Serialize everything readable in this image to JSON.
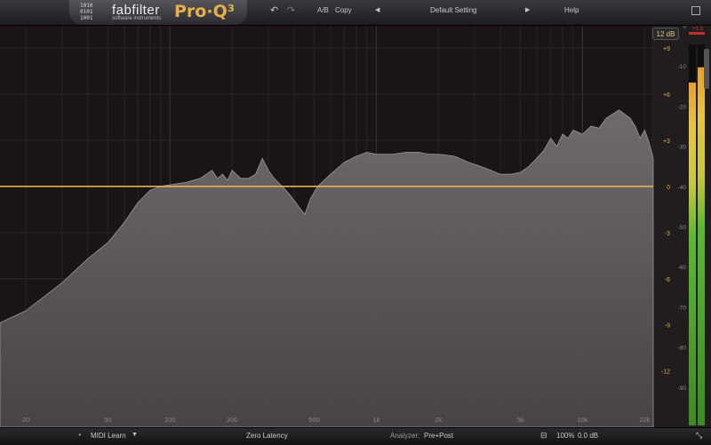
{
  "app": {
    "brand": "fabfilter",
    "brand_sub": "software instruments",
    "product": "Pro·Q³",
    "logo_bits": "1010\n0101\n1001"
  },
  "toolbar": {
    "undo_icon": "undo-icon",
    "redo_icon": "redo-icon",
    "ab_label": "A/B",
    "copy_label": "Copy",
    "preset_name": "Default Setting",
    "help_label": "Help"
  },
  "range": {
    "label": "12 dB"
  },
  "eq_scale": [
    "+9",
    "+6",
    "+3",
    "0",
    "-3",
    "-6",
    "-9",
    "-12"
  ],
  "eq_scale_values": [
    9,
    6,
    3,
    0,
    -3,
    -6,
    -9,
    -12
  ],
  "analyzer_scale": [
    "0",
    "-10",
    "-20",
    "-30",
    "-40",
    "-50",
    "-60",
    "-70",
    "-80",
    "-90"
  ],
  "meter_peak": "+3.3",
  "freq_labels": [
    "20",
    "50",
    "100",
    "200",
    "500",
    "1k",
    "2k",
    "5k",
    "10k",
    "20k"
  ],
  "freq_values": [
    20,
    50,
    100,
    200,
    500,
    1000,
    2000,
    5000,
    10000,
    20000
  ],
  "bottombar": {
    "midi_learn": "MIDI Learn",
    "latency": "Zero Latency",
    "analyzer_label": "Analyzer:",
    "analyzer_value": "Pre+Post",
    "zoom": "100%",
    "gain": "0.0 dB"
  },
  "colors": {
    "background": "#1a1416",
    "eq_curve": "#e8b04a",
    "spectrum_fill": "#6f6a6e",
    "meter_green": "#5cb82e",
    "meter_yellow": "#e5c73a"
  },
  "meters": {
    "left_level": 0.9,
    "right_level": 0.94
  },
  "chart_data": {
    "type": "area",
    "xscale": "log",
    "xlim": [
      15,
      22000
    ],
    "ylim": [
      -100,
      0
    ],
    "eq_gain_db": 0,
    "spectrum": [
      [
        15,
        -74
      ],
      [
        20,
        -71
      ],
      [
        30,
        -64
      ],
      [
        40,
        -58
      ],
      [
        50,
        -54
      ],
      [
        60,
        -49
      ],
      [
        70,
        -44
      ],
      [
        80,
        -41
      ],
      [
        90,
        -40
      ],
      [
        100,
        -39.6
      ],
      [
        120,
        -39
      ],
      [
        140,
        -38
      ],
      [
        150,
        -37
      ],
      [
        160,
        -36
      ],
      [
        170,
        -38
      ],
      [
        180,
        -37
      ],
      [
        190,
        -38.5
      ],
      [
        200,
        -36
      ],
      [
        220,
        -38
      ],
      [
        240,
        -38
      ],
      [
        260,
        -37
      ],
      [
        280,
        -33
      ],
      [
        300,
        -36
      ],
      [
        320,
        -38
      ],
      [
        350,
        -40
      ],
      [
        380,
        -42
      ],
      [
        420,
        -45
      ],
      [
        450,
        -47
      ],
      [
        480,
        -43
      ],
      [
        520,
        -40
      ],
      [
        600,
        -37
      ],
      [
        700,
        -34
      ],
      [
        800,
        -32.5
      ],
      [
        900,
        -31.5
      ],
      [
        1000,
        -32
      ],
      [
        1200,
        -32
      ],
      [
        1400,
        -31.5
      ],
      [
        1600,
        -31.5
      ],
      [
        1800,
        -32
      ],
      [
        2000,
        -32
      ],
      [
        2400,
        -32.5
      ],
      [
        2800,
        -34
      ],
      [
        3200,
        -35
      ],
      [
        3600,
        -36
      ],
      [
        4000,
        -37
      ],
      [
        4500,
        -37
      ],
      [
        5000,
        -36.5
      ],
      [
        5500,
        -35
      ],
      [
        6000,
        -33
      ],
      [
        6500,
        -31
      ],
      [
        7000,
        -28
      ],
      [
        7500,
        -30
      ],
      [
        8000,
        -27
      ],
      [
        8500,
        -28
      ],
      [
        9000,
        -26
      ],
      [
        10000,
        -27
      ],
      [
        11000,
        -25
      ],
      [
        12000,
        -25.5
      ],
      [
        13000,
        -23
      ],
      [
        14000,
        -22
      ],
      [
        15000,
        -21
      ],
      [
        16000,
        -22
      ],
      [
        17000,
        -23
      ],
      [
        18000,
        -25
      ],
      [
        19000,
        -28
      ],
      [
        20000,
        -26
      ],
      [
        21000,
        -29
      ],
      [
        22000,
        -33
      ]
    ]
  }
}
